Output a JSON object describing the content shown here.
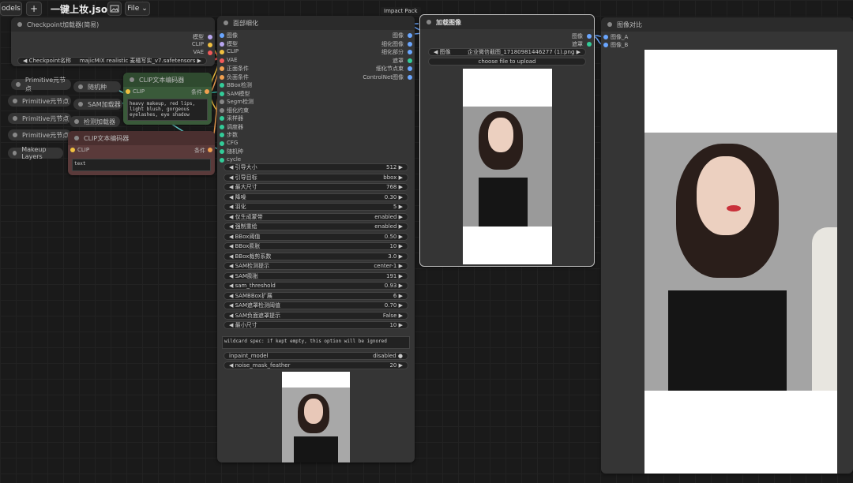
{
  "topbar": {
    "models": "odels",
    "add": "+",
    "workflow_title": "一键上妆.json",
    "file": "File"
  },
  "impact_pack": "Impact Pack",
  "checkpoint": {
    "title": "Checkpoint加载器(简易)",
    "out_model": "模型",
    "out_clip": "CLIP",
    "out_vae": "VAE",
    "widget_label": "Checkpoint名称",
    "widget_value": "majicMIX realistic 麦橘写实_v7.safetensors"
  },
  "primitives": [
    {
      "label": "Primitive元节点"
    },
    {
      "label": "Primitive元节点"
    },
    {
      "label": "Primitive元节点"
    },
    {
      "label": "Primitive元节点"
    }
  ],
  "makeup_layers": "Makeup Layers",
  "seed_node": "随机种",
  "sam_node": "SAM加载器",
  "detector_node": "检测加载器",
  "clip_pos": {
    "title": "CLIP文本编码器",
    "in": "CLIP",
    "out": "条件",
    "text": "heavy makeup, red lips, light blush, gorgeous eyelashes, eye shadow"
  },
  "clip_neg": {
    "title": "CLIP文本编码器",
    "in": "CLIP",
    "out": "条件",
    "text": "text"
  },
  "detailer": {
    "title": "面部细化",
    "inputs": [
      "图像",
      "模型",
      "CLIP",
      "VAE",
      "正面条件",
      "负面条件",
      "BBox检测",
      "SAM模型",
      "Segm检测",
      "细化约束",
      "采样器",
      "调度器",
      "步数",
      "CFG",
      "随机种",
      "cycle"
    ],
    "outputs": [
      "图像",
      "细化图像",
      "细化部分",
      "遮罩",
      "细化节点束",
      "ControlNet图像"
    ],
    "widgets": [
      {
        "label": "引导大小",
        "value": "512"
      },
      {
        "label": "引导目标",
        "value": "bbox"
      },
      {
        "label": "最大尺寸",
        "value": "768"
      },
      {
        "label": "降噪",
        "value": "0.30"
      },
      {
        "label": "羽化",
        "value": "5"
      },
      {
        "label": "仅生成蒙带",
        "value": "enabled"
      },
      {
        "label": "强制重绘",
        "value": "enabled"
      },
      {
        "label": "BBox阈值",
        "value": "0.50"
      },
      {
        "label": "BBox膨胀",
        "value": "10"
      },
      {
        "label": "BBox裁剪系数",
        "value": "3.0"
      },
      {
        "label": "SAM检测提示",
        "value": "center-1"
      },
      {
        "label": "SAM膨胀",
        "value": "191"
      },
      {
        "label": "sam_threshold",
        "value": "0.93"
      },
      {
        "label": "SAMBBox扩展",
        "value": "6"
      },
      {
        "label": "SAM遮罩检测阈值",
        "value": "0.70"
      },
      {
        "label": "SAM负面遮罩提示",
        "value": "False"
      },
      {
        "label": "最小尺寸",
        "value": "10"
      }
    ],
    "wildcard": "wildcard spec: if kept empty, this option will be ignored",
    "inpaint_label": "inpaint_model",
    "inpaint_value": "disabled",
    "noise_label": "noise_mask_feather",
    "noise_value": "20"
  },
  "load_image": {
    "title": "加载图像",
    "out_image": "图像",
    "out_mask": "遮罩",
    "widget_label": "图像",
    "widget_value": "企业微信截图_17180981446277 (1).png",
    "upload": "choose file to upload"
  },
  "compare": {
    "title": "图像对比",
    "in_a": "图像_A",
    "in_b": "图像_B"
  },
  "colors": {
    "clip_green": "#2f4a2f",
    "clip_red": "#4a2f2f",
    "wire_yellow": "#f0c040",
    "wire_blue": "#6aa6ff"
  }
}
